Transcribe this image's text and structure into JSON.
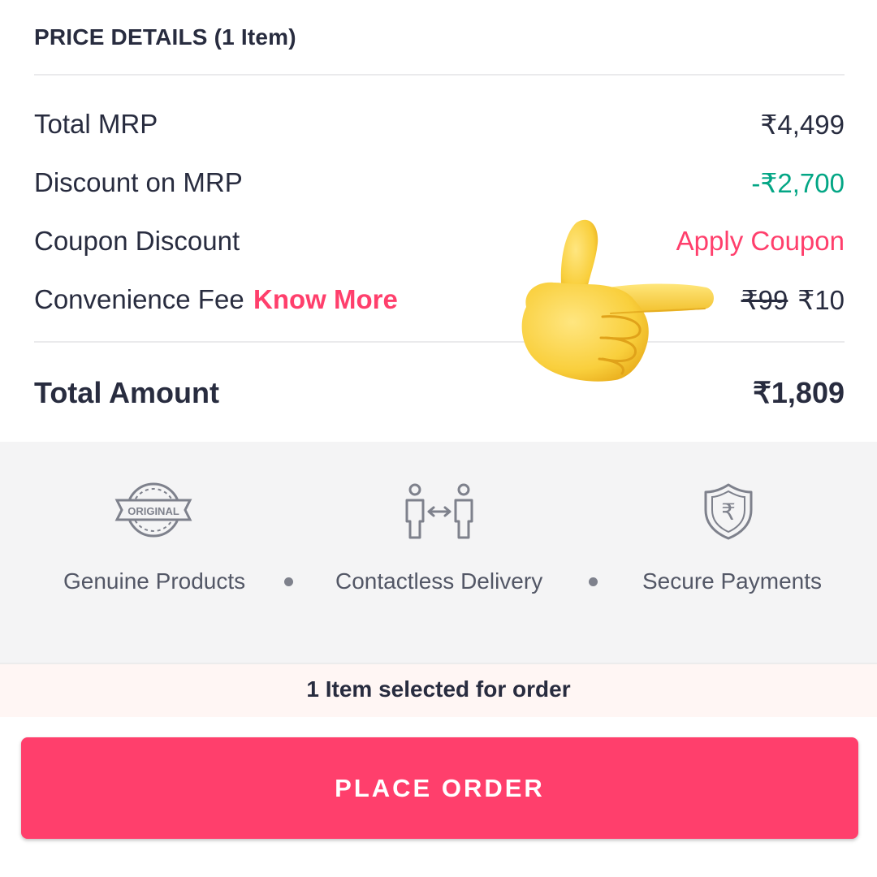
{
  "price_details": {
    "title": "PRICE DETAILS (1 Item)",
    "rows": [
      {
        "label": "Total MRP",
        "value": "₹4,499"
      },
      {
        "label": "Discount on MRP",
        "value": "-₹2,700"
      },
      {
        "label": "Coupon Discount",
        "value": "Apply Coupon"
      },
      {
        "label": "Convenience Fee",
        "link": "Know More",
        "old_value": "₹99",
        "value": "₹10"
      }
    ],
    "total_label": "Total Amount",
    "total_value": "₹1,809"
  },
  "pointer_icon": "pointing-right-hand-emoji",
  "trust": {
    "items": [
      {
        "icon": "original-badge-icon",
        "badge_text": "ORIGINAL",
        "label": "Genuine Products"
      },
      {
        "icon": "contactless-delivery-icon",
        "label": "Contactless Delivery"
      },
      {
        "icon": "rupee-shield-icon",
        "symbol": "₹",
        "label": "Secure Payments"
      }
    ]
  },
  "selection_text": "1 Item selected for order",
  "place_order_label": "PLACE ORDER",
  "colors": {
    "accent": "#ff3f6c",
    "discount_green": "#03a685",
    "text_dark": "#282c3f",
    "trust_bg": "#f4f4f5",
    "selection_bg": "#fff6f4"
  }
}
